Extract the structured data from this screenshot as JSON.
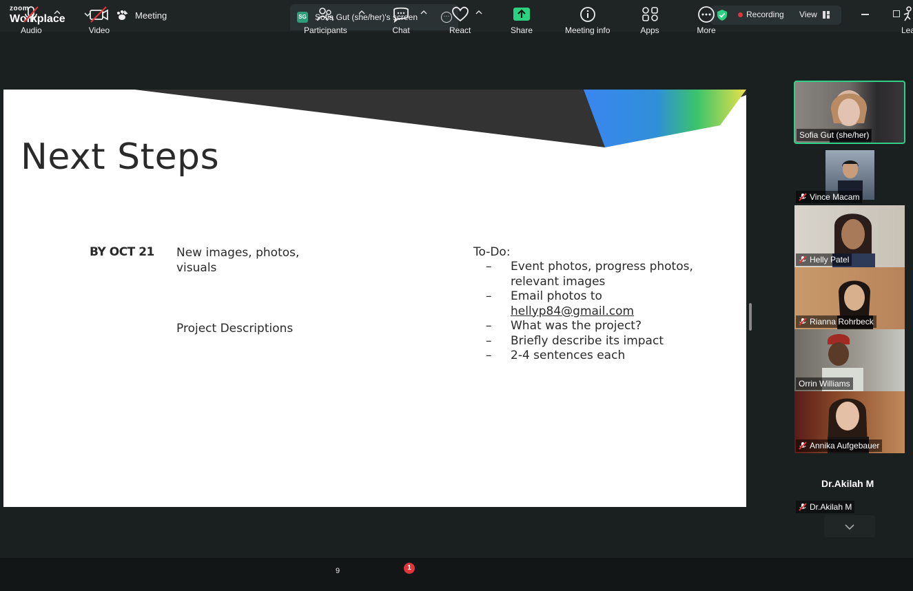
{
  "app": {
    "brand_top": "zoom",
    "brand_bottom": "Workplace"
  },
  "titlebar": {
    "meeting_tab": "Meeting",
    "screen_tab_initials": "SG",
    "screen_tab_label": "Sofia Gut (she/her)'s screen",
    "recording_label": "Recording",
    "view_label": "View"
  },
  "slide": {
    "title": "Next Steps",
    "date_label": "BY OCT 21",
    "item1": "New images, photos, visuals",
    "item2": "Project Descriptions",
    "todo_heading": "To-Do:",
    "todo_items": [
      "Event photos, progress photos, relevant images",
      "Email photos to",
      "What was the project?",
      "Briefly describe its impact",
      "2-4 sentences each"
    ],
    "email": "hellyp84@gmail.com",
    "dash": "–"
  },
  "participants": [
    {
      "name": "Sofia Gut (she/her)",
      "muted": false,
      "active": true
    },
    {
      "name": "Vince Macam",
      "muted": true
    },
    {
      "name": "Helly Patel",
      "muted": true
    },
    {
      "name": "Rianna Rohrbeck",
      "muted": true
    },
    {
      "name": "Orrin Williams",
      "muted": false
    },
    {
      "name": "Annika Aufgebauer",
      "muted": true
    },
    {
      "name": "Dr.Akilah M",
      "muted": true
    }
  ],
  "akilah_display_name": "Dr.Akilah M",
  "toolbar": {
    "audio": "Audio",
    "video": "Video",
    "participants": "Participants",
    "participants_count": "9",
    "chat": "Chat",
    "chat_badge": "1",
    "react": "React",
    "share": "Share",
    "meeting_info": "Meeting info",
    "apps": "Apps",
    "more": "More",
    "leave": "Lea"
  },
  "colors": {
    "accent_green": "#31d08a",
    "share_green": "#2bd180",
    "badge_red": "#e0353b"
  }
}
